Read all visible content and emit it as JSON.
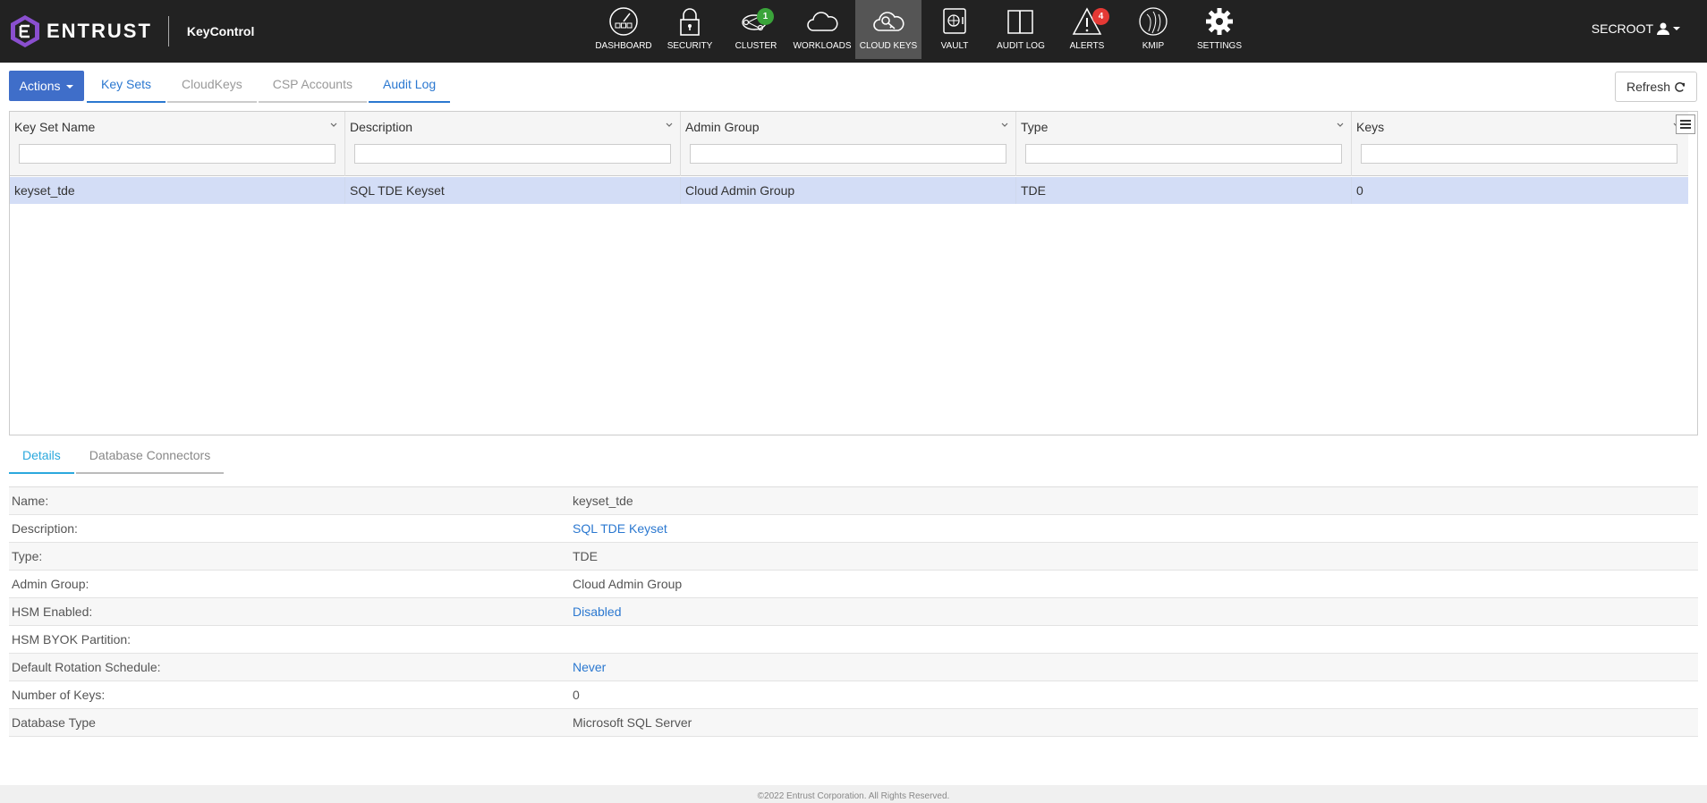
{
  "header": {
    "brand_name": "ENTRUST",
    "product_name": "KeyControl",
    "user_name": "SECROOT",
    "nav": [
      {
        "label": "DASHBOARD",
        "icon": "dashboard-icon"
      },
      {
        "label": "SECURITY",
        "icon": "lock-icon"
      },
      {
        "label": "CLUSTER",
        "icon": "cluster-icon",
        "badge": "1",
        "badge_color": "#3aa43a"
      },
      {
        "label": "WORKLOADS",
        "icon": "cloud-icon"
      },
      {
        "label": "CLOUD KEYS",
        "icon": "cloud-key-icon",
        "active": true
      },
      {
        "label": "VAULT",
        "icon": "vault-icon"
      },
      {
        "label": "AUDIT LOG",
        "icon": "book-icon"
      },
      {
        "label": "ALERTS",
        "icon": "warning-icon",
        "badge": "4",
        "badge_color": "#e53935"
      },
      {
        "label": "KMIP",
        "icon": "kmip-icon"
      },
      {
        "label": "SETTINGS",
        "icon": "gear-icon"
      }
    ]
  },
  "toolbar": {
    "actions_label": "Actions",
    "tabs": [
      "Key Sets",
      "CloudKeys",
      "CSP Accounts",
      "Audit Log"
    ],
    "refresh_label": "Refresh"
  },
  "grid": {
    "columns": [
      "Key Set Name",
      "Description",
      "Admin Group",
      "Type",
      "Keys"
    ],
    "rows": [
      [
        "keyset_tde",
        "SQL TDE Keyset",
        "Cloud Admin Group",
        "TDE",
        "0"
      ]
    ]
  },
  "details": {
    "tabs": [
      "Details",
      "Database Connectors"
    ],
    "rows": [
      {
        "label": "Name:",
        "value": "keyset_tde"
      },
      {
        "label": "Description:",
        "value": "SQL TDE Keyset"
      },
      {
        "label": "Type:",
        "value": "TDE"
      },
      {
        "label": "Admin Group:",
        "value": "Cloud Admin Group"
      },
      {
        "label": "HSM Enabled:",
        "value": "Disabled"
      },
      {
        "label": "HSM BYOK Partition:",
        "value": ""
      },
      {
        "label": "Default Rotation Schedule:",
        "value": "Never"
      },
      {
        "label": "Number of Keys:",
        "value": "0"
      },
      {
        "label": "Database Type",
        "value": "Microsoft SQL Server"
      }
    ]
  },
  "footer": {
    "copyright": "©2022 Entrust Corporation. All Rights Reserved."
  },
  "colors": {
    "topbar": "#222222",
    "accent_blue": "#3f6ec9",
    "link_blue": "#2b78d0",
    "selected_row": "#d3ddf6",
    "detail_tab_active": "#2ba8dd",
    "logo_purple": "#8a4fcf"
  }
}
